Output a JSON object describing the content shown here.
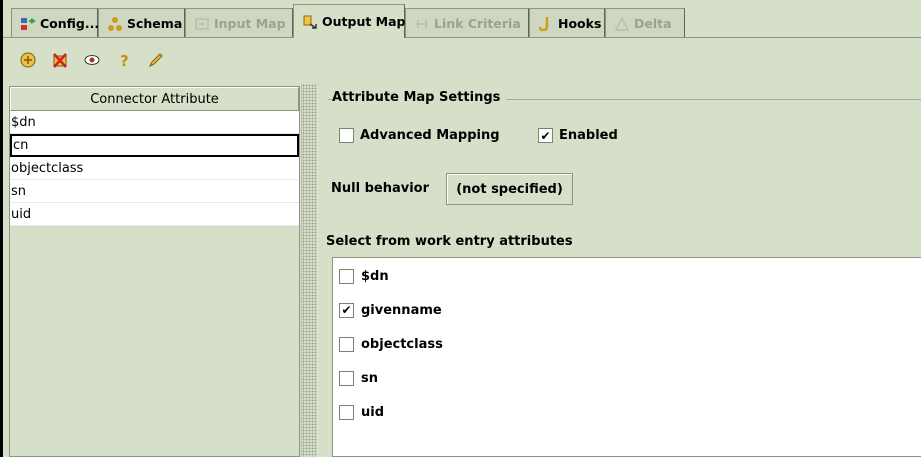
{
  "tabs": [
    {
      "label": "Config...",
      "icon": "config-icon",
      "state": "normal"
    },
    {
      "label": "Schema",
      "icon": "schema-icon",
      "state": "normal"
    },
    {
      "label": "Input Map",
      "icon": "input-map-icon",
      "state": "disabled"
    },
    {
      "label": "Output Map",
      "icon": "output-map-icon",
      "state": "active"
    },
    {
      "label": "Link Criteria",
      "icon": "link-criteria-icon",
      "state": "disabled"
    },
    {
      "label": "Hooks",
      "icon": "hooks-icon",
      "state": "normal"
    },
    {
      "label": "Delta",
      "icon": "delta-icon",
      "state": "disabled"
    }
  ],
  "toolbar": {
    "buttons": [
      "add-attribute-icon",
      "delete-attribute-icon",
      "view-icon",
      "help-icon",
      "edit-icon"
    ]
  },
  "left_panel": {
    "header": "Connector Attribute",
    "rows": [
      "$dn",
      "cn",
      "objectclass",
      "sn",
      "uid"
    ],
    "selected": "cn"
  },
  "settings": {
    "title": "Attribute Map Settings",
    "advanced_label": "Advanced Mapping",
    "advanced_checked": false,
    "enabled_label": "Enabled",
    "enabled_checked": true,
    "null_label": "Null behavior",
    "null_value": "(not specified)"
  },
  "work_entry": {
    "title": "Select from work entry attributes",
    "items": [
      {
        "label": "$dn",
        "checked": false
      },
      {
        "label": "givenname",
        "checked": true
      },
      {
        "label": "objectclass",
        "checked": false
      },
      {
        "label": "sn",
        "checked": false
      },
      {
        "label": "uid",
        "checked": false
      }
    ]
  },
  "colors": {
    "panel_bg": "#d6dfc8",
    "border": "#8a9680",
    "disabled_text": "#9aa391"
  }
}
